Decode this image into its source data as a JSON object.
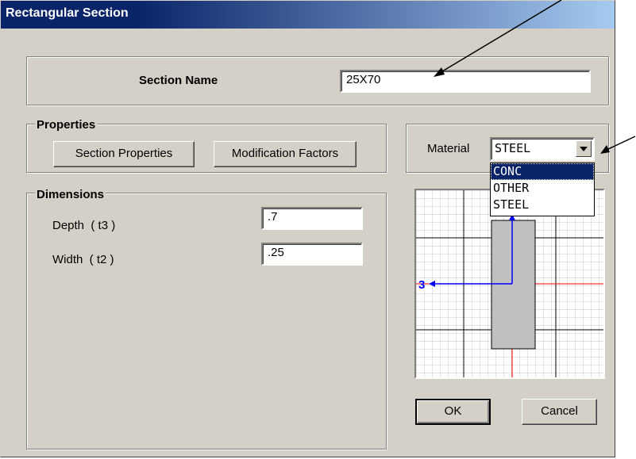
{
  "window": {
    "title": "Rectangular Section"
  },
  "section_name": {
    "label": "Section Name",
    "value": "25X70"
  },
  "properties": {
    "group_label": "Properties",
    "section_properties_button": "Section Properties",
    "modification_factors_button": "Modification Factors"
  },
  "material": {
    "label": "Material",
    "selected": "STEEL",
    "options": [
      "CONC",
      "OTHER",
      "STEEL"
    ],
    "highlighted": "CONC"
  },
  "dimensions": {
    "group_label": "Dimensions",
    "depth": {
      "label": "Depth  ( t3 )",
      "value": ".7"
    },
    "width": {
      "label": "Width  ( t2 )",
      "value": ".25"
    }
  },
  "preview": {
    "axis_label": "3"
  },
  "buttons": {
    "ok": "OK",
    "cancel": "Cancel"
  },
  "colors": {
    "titlebar": "#0a246a",
    "dialog_bg": "#d4d0c8",
    "axis_blue": "#0000ff",
    "axis_red": "#ff0000",
    "section_fill": "#c0c0c0"
  }
}
